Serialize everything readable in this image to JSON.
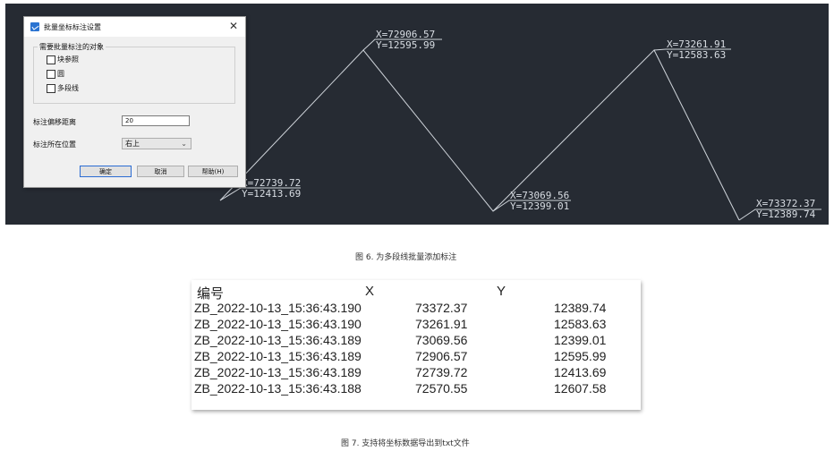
{
  "dialog": {
    "title": "批量坐标标注设置",
    "close": "✕",
    "group_label": "需要批量标注的对象",
    "checkboxes": [
      "块参照",
      "圆",
      "多段线"
    ],
    "offset_label": "标注偏移距离",
    "offset_value": "20",
    "position_label": "标注所在位置",
    "position_value": "右上",
    "buttons": {
      "ok": "确定",
      "cancel": "取消",
      "help": "帮助(H)"
    }
  },
  "cad": {
    "labels": [
      {
        "x": "X=72739.72",
        "y": "Y=12413.69"
      },
      {
        "x": "X=72906.57",
        "y": "Y=12595.99"
      },
      {
        "x": "X=73069.56",
        "y": "Y=12399.01"
      },
      {
        "x": "X=73261.91",
        "y": "Y=12583.63"
      },
      {
        "x": "X=73372.37",
        "y": "Y=12389.74"
      }
    ]
  },
  "caption1": "图 6. 为多段线批量添加标注",
  "table": {
    "headers": [
      "编号",
      "X",
      "Y"
    ],
    "rows": [
      [
        "ZB_2022-10-13_15:36:43.190",
        "73372.37",
        "12389.74"
      ],
      [
        "ZB_2022-10-13_15:36:43.190",
        "73261.91",
        "12583.63"
      ],
      [
        "ZB_2022-10-13_15:36:43.189",
        "73069.56",
        "12399.01"
      ],
      [
        "ZB_2022-10-13_15:36:43.189",
        "72906.57",
        "12595.99"
      ],
      [
        "ZB_2022-10-13_15:36:43.189",
        "72739.72",
        "12413.69"
      ],
      [
        "ZB_2022-10-13_15:36:43.188",
        "72570.55",
        "12607.58"
      ]
    ]
  },
  "caption2": "图 7. 支持将坐标数据导出到txt文件"
}
